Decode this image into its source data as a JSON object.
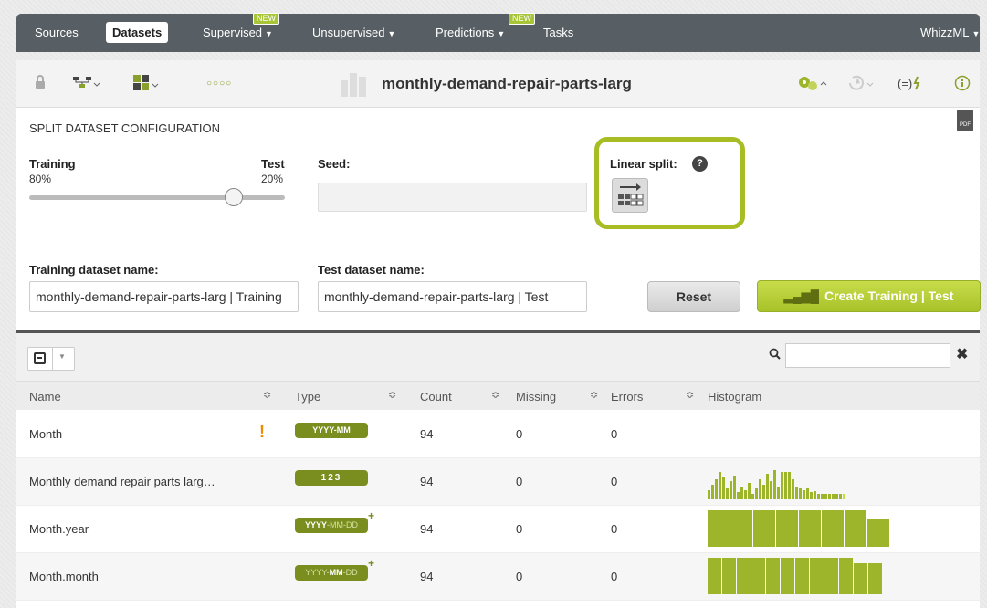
{
  "nav": {
    "items": [
      {
        "label": "Sources",
        "active": false
      },
      {
        "label": "Datasets",
        "active": true
      },
      {
        "label": "Supervised",
        "caret": true,
        "badge": "NEW"
      },
      {
        "label": "Unsupervised",
        "caret": true
      },
      {
        "label": "Predictions",
        "caret": true,
        "badge": "NEW"
      },
      {
        "label": "Tasks"
      }
    ],
    "user": "WhizzML"
  },
  "dataset": {
    "title": "monthly-demand-repair-parts-larg"
  },
  "split": {
    "section_title": "SPLIT DATASET CONFIGURATION",
    "training_label": "Training",
    "training_pct": "80%",
    "test_label": "Test",
    "test_pct": "20%",
    "slider_fraction": 0.8,
    "seed_label": "Seed:",
    "seed_value": "",
    "linear_split_label": "Linear split:",
    "training_name_label": "Training dataset name:",
    "training_name_value": "monthly-demand-repair-parts-larg | Training",
    "test_name_label": "Test dataset name:",
    "test_name_value": "monthly-demand-repair-parts-larg | Test",
    "reset_label": "Reset",
    "create_label": "Create Training | Test"
  },
  "table": {
    "search_placeholder": "",
    "headers": [
      "Name",
      "Type",
      "Count",
      "Missing",
      "Errors",
      "Histogram"
    ],
    "rows": [
      {
        "name": "Month",
        "type": "YYYY-MM",
        "count": "94",
        "missing": "0",
        "errors": "0",
        "warning": true
      },
      {
        "name": "Monthly demand repair parts larg…",
        "type": "123",
        "count": "94",
        "missing": "0",
        "errors": "0"
      },
      {
        "name": "Month.year",
        "type": "YYYY-MM-DD",
        "count": "94",
        "missing": "0",
        "errors": "0",
        "derived": true
      },
      {
        "name": "Month.month",
        "type": "YYYY-MM-DD",
        "count": "94",
        "missing": "0",
        "errors": "0",
        "derived": true
      }
    ]
  },
  "colors": {
    "accent": "#a8bd24",
    "nav_bg": "#575f64",
    "badge": "#7a8e20",
    "warning": "#f08a00"
  }
}
